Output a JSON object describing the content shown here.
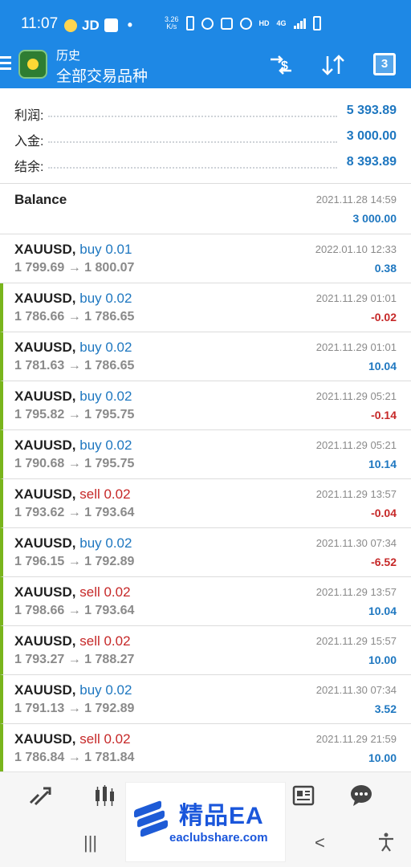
{
  "status": {
    "time": "11:07",
    "carrier": "JD",
    "speed": "3.26\nK/s",
    "net": "4G"
  },
  "header": {
    "title": "历史",
    "subtitle": "全部交易品种",
    "calendar_day": "3"
  },
  "summary": [
    {
      "label": "利润:",
      "value": "5 393.89"
    },
    {
      "label": "入金:",
      "value": "3 000.00"
    },
    {
      "label": "结余:",
      "value": "8 393.89"
    }
  ],
  "balance": {
    "label": "Balance",
    "date": "2021.11.28 14:59",
    "amount": "3 000.00"
  },
  "trades": [
    {
      "symbol": "XAUUSD,",
      "side": "buy 0.01",
      "dir": "buy",
      "prices": "1 799.69 → 1 800.07",
      "date": "2022.01.10 12:33",
      "profit": "0.38",
      "sign": "pos",
      "open": false
    },
    {
      "symbol": "XAUUSD,",
      "side": "buy 0.02",
      "dir": "buy",
      "prices": "1 786.66 → 1 786.65",
      "date": "2021.11.29 01:01",
      "profit": "-0.02",
      "sign": "neg",
      "open": true
    },
    {
      "symbol": "XAUUSD,",
      "side": "buy 0.02",
      "dir": "buy",
      "prices": "1 781.63 → 1 786.65",
      "date": "2021.11.29 01:01",
      "profit": "10.04",
      "sign": "pos",
      "open": true
    },
    {
      "symbol": "XAUUSD,",
      "side": "buy 0.02",
      "dir": "buy",
      "prices": "1 795.82 → 1 795.75",
      "date": "2021.11.29 05:21",
      "profit": "-0.14",
      "sign": "neg",
      "open": true
    },
    {
      "symbol": "XAUUSD,",
      "side": "buy 0.02",
      "dir": "buy",
      "prices": "1 790.68 → 1 795.75",
      "date": "2021.11.29 05:21",
      "profit": "10.14",
      "sign": "pos",
      "open": true
    },
    {
      "symbol": "XAUUSD,",
      "side": "sell 0.02",
      "dir": "sell",
      "prices": "1 793.62 → 1 793.64",
      "date": "2021.11.29 13:57",
      "profit": "-0.04",
      "sign": "neg",
      "open": true
    },
    {
      "symbol": "XAUUSD,",
      "side": "buy 0.02",
      "dir": "buy",
      "prices": "1 796.15 → 1 792.89",
      "date": "2021.11.30 07:34",
      "profit": "-6.52",
      "sign": "neg",
      "open": true
    },
    {
      "symbol": "XAUUSD,",
      "side": "sell 0.02",
      "dir": "sell",
      "prices": "1 798.66 → 1 793.64",
      "date": "2021.11.29 13:57",
      "profit": "10.04",
      "sign": "pos",
      "open": true
    },
    {
      "symbol": "XAUUSD,",
      "side": "sell 0.02",
      "dir": "sell",
      "prices": "1 793.27 → 1 788.27",
      "date": "2021.11.29 15:57",
      "profit": "10.00",
      "sign": "pos",
      "open": true
    },
    {
      "symbol": "XAUUSD,",
      "side": "buy 0.02",
      "dir": "buy",
      "prices": "1 791.13 → 1 792.89",
      "date": "2021.11.30 07:34",
      "profit": "3.52",
      "sign": "pos",
      "open": true
    },
    {
      "symbol": "XAUUSD,",
      "side": "sell 0.02",
      "dir": "sell",
      "prices": "1 786.84 → 1 781.84",
      "date": "2021.11.29 21:59",
      "profit": "10.00",
      "sign": "pos",
      "open": true
    }
  ],
  "bottom_nav": [
    {
      "icon": "quotes-icon"
    },
    {
      "icon": "chart-icon"
    },
    {
      "icon": "trade-icon"
    },
    {
      "icon": "history-icon"
    },
    {
      "icon": "news-icon"
    },
    {
      "icon": "chat-icon"
    }
  ],
  "watermark": {
    "title": "精品EA",
    "url": "eaclubshare.com"
  },
  "colors": {
    "header_blue": "#1e88e5",
    "profit_blue": "#1e77c0",
    "loss_red": "#c62828",
    "open_marker": "#79b51c"
  }
}
